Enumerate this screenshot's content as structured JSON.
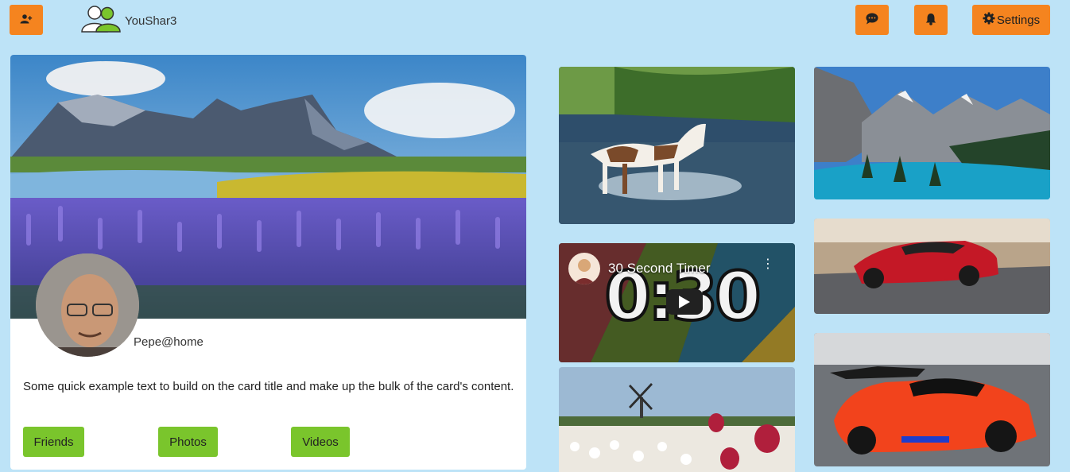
{
  "brand": {
    "name": "YouShar3"
  },
  "header": {
    "add_user_icon": "add-user-icon",
    "chat_icon": "chat-icon",
    "bell_icon": "bell-icon",
    "settings_label": "Settings",
    "settings_icon": "gear-icon"
  },
  "profile": {
    "username": "Pepe@home",
    "text": "Some quick example text to build on the card title and make up the bulk of the card's content.",
    "buttons": {
      "friends": "Friends",
      "photos": "Photos",
      "videos": "Videos"
    }
  },
  "video": {
    "title": "30 Second Timer",
    "timer": "0:30"
  },
  "colors": {
    "background": "#bde3f7",
    "accent": "#f5841f",
    "green": "#7ac52c"
  }
}
